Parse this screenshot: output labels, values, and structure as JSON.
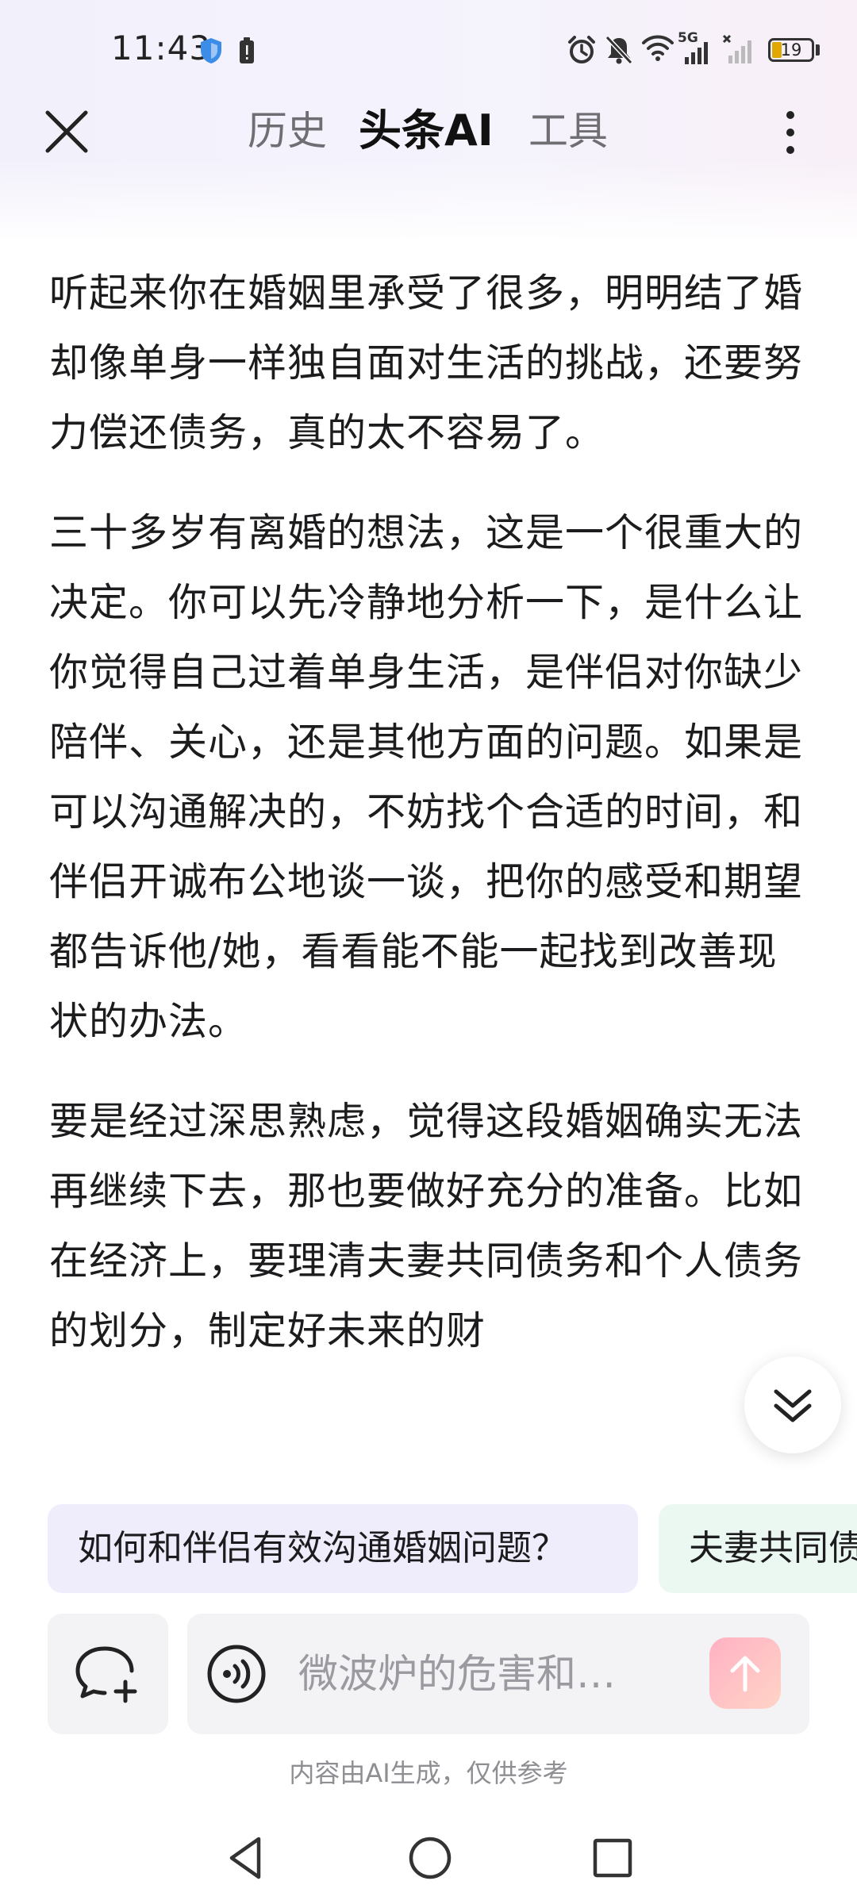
{
  "status_bar": {
    "time": "11:43",
    "battery": "19",
    "network_label": "5G"
  },
  "nav": {
    "tabs": [
      {
        "label": "历史"
      },
      {
        "label": "头条AI"
      },
      {
        "label": "工具"
      }
    ],
    "active_tab": "头条AI"
  },
  "content": {
    "paragraphs": [
      "听起来你在婚姻里承受了很多，明明结了婚却像单身一样独自面对生活的挑战，还要努力偿还债务，真的太不容易了。",
      "三十多岁有离婚的想法，这是一个很重大的决定。你可以先冷静地分析一下，是什么让你觉得自己过着单身生活，是伴侣对你缺少陪伴、关心，还是其他方面的问题。如果是可以沟通解决的，不妨找个合适的时间，和伴侣开诚布公地谈一谈，把你的感受和期望都告诉他/她，看看能不能一起找到改善现状的办法。",
      "要是经过深思熟虑，觉得这段婚姻确实无法再继续下去，那也要做好充分的准备。比如在经济上，要理清夫妻共同债务和个人债务的划分，制定好未来的财"
    ]
  },
  "suggestions": [
    "如何和伴侣有效沟通婚姻问题？",
    "夫妻共同债"
  ],
  "input": {
    "placeholder": "微波炉的危害和…"
  },
  "disclaimer": "内容由AI生成，仅供参考",
  "colors": {
    "accent_gradient_start": "#ffb1c4",
    "chip_purple": "#efedfb",
    "chip_green": "#ebf7f1"
  }
}
